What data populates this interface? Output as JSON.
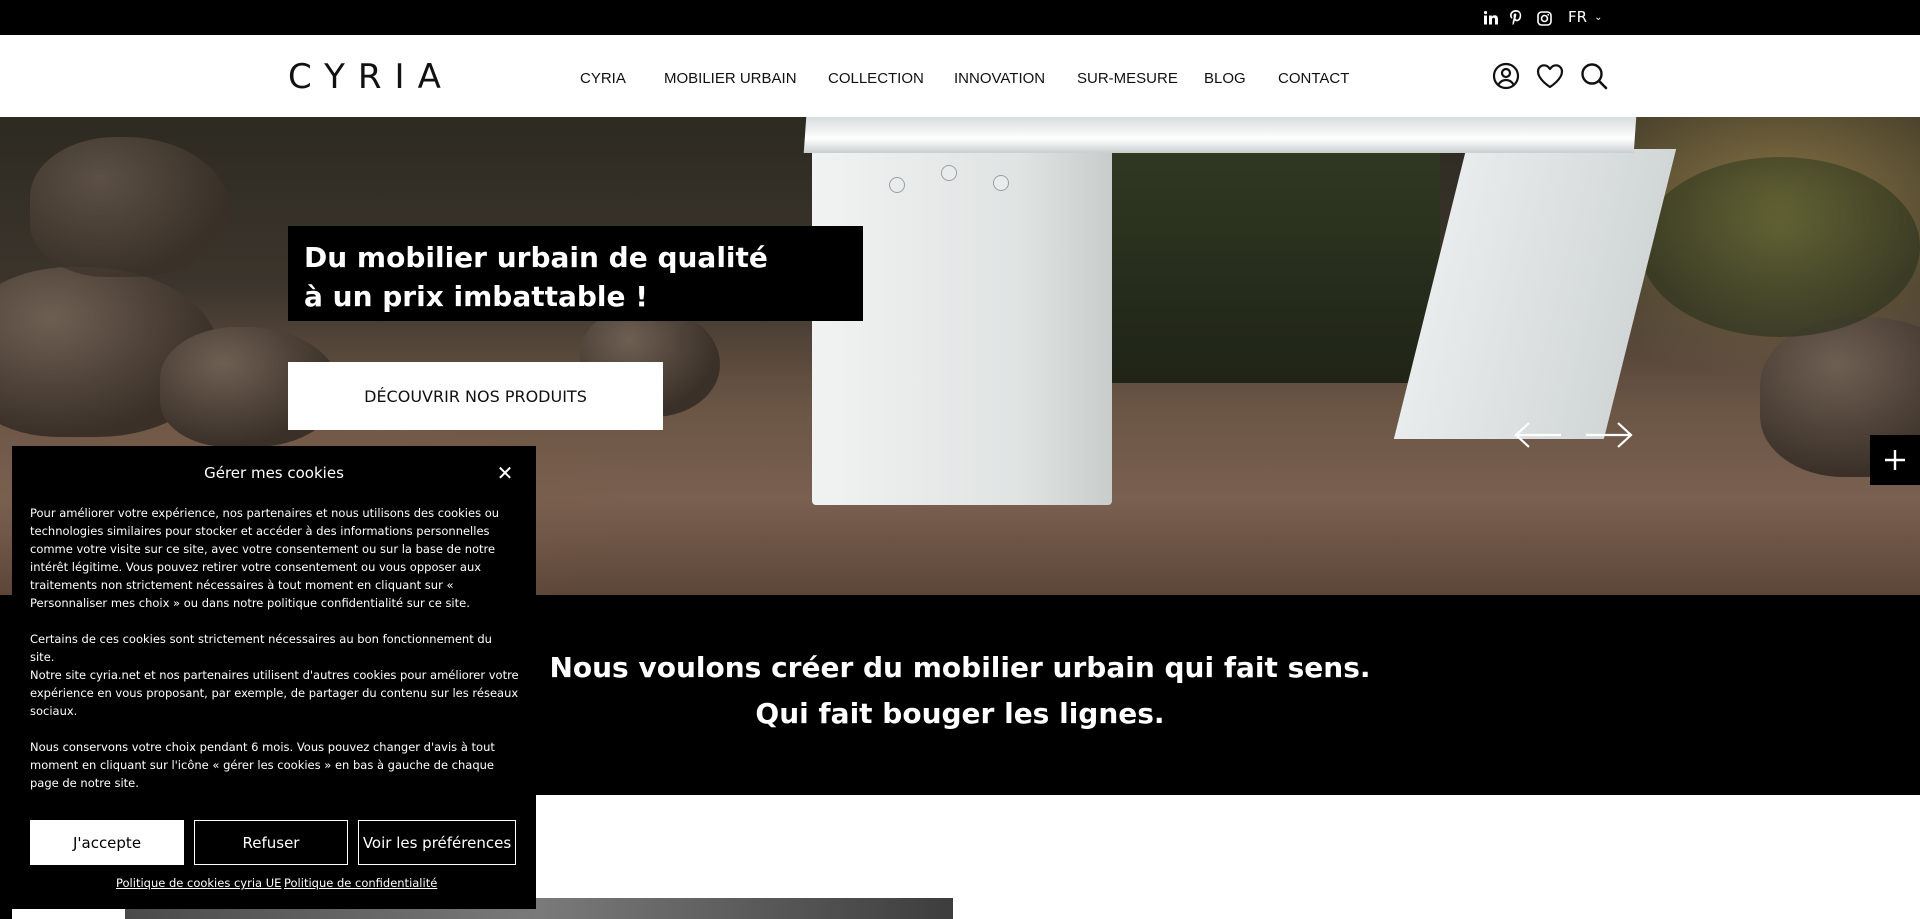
{
  "topbar": {
    "social": [
      {
        "name": "linkedin-icon"
      },
      {
        "name": "pinterest-icon"
      },
      {
        "name": "instagram-icon"
      }
    ],
    "language": "FR"
  },
  "header": {
    "logo": "CYRIA",
    "nav": [
      "CYRIA",
      "MOBILIER URBAIN",
      "COLLECTION",
      "INNOVATION",
      "SUR-MESURE",
      "BLOG",
      "CONTACT"
    ],
    "icons": [
      "account-icon",
      "heart-icon",
      "search-icon"
    ]
  },
  "hero": {
    "title_line1": "Du mobilier urbain de qualité",
    "title_line2": "à un prix imbattable !",
    "cta": "DÉCOUVRIR NOS PRODUITS"
  },
  "manifesto": {
    "line1": "Nous voulons créer du mobilier urbain qui fait sens.",
    "line2": "Qui fait bouger les lignes."
  },
  "cookie": {
    "title": "Gérer mes cookies",
    "p1": "Pour améliorer votre expérience, nos partenaires et nous utilisons des cookies ou technologies similaires pour stocker et accéder à des informations personnelles comme votre visite sur ce site, avec votre consentement ou sur la base de notre intérêt légitime. Vous pouvez retirer votre consentement ou vous opposer aux traitements non strictement nécessaires à tout moment en cliquant sur « Personnaliser mes choix » ou dans notre politique confidentialité sur ce site.",
    "p2": "Certains de ces cookies sont strictement nécessaires au bon fonctionnement du site.",
    "p3": "Notre site cyria.net et nos partenaires utilisent d'autres cookies pour améliorer votre expérience en vous proposant, par exemple, de partager du contenu sur les réseaux sociaux.",
    "p4": "Nous conservons votre choix pendant 6 mois. Vous pouvez changer d'avis à tout moment en cliquant sur l'icône « gérer les cookies » en bas à gauche de chaque page de notre site.",
    "accept": "J'accepte",
    "refuse": "Refuser",
    "preferences": "Voir les préférences",
    "link_cookies": "Politique de cookies cyria UE",
    "link_privacy": "Politique de confidentialité"
  }
}
